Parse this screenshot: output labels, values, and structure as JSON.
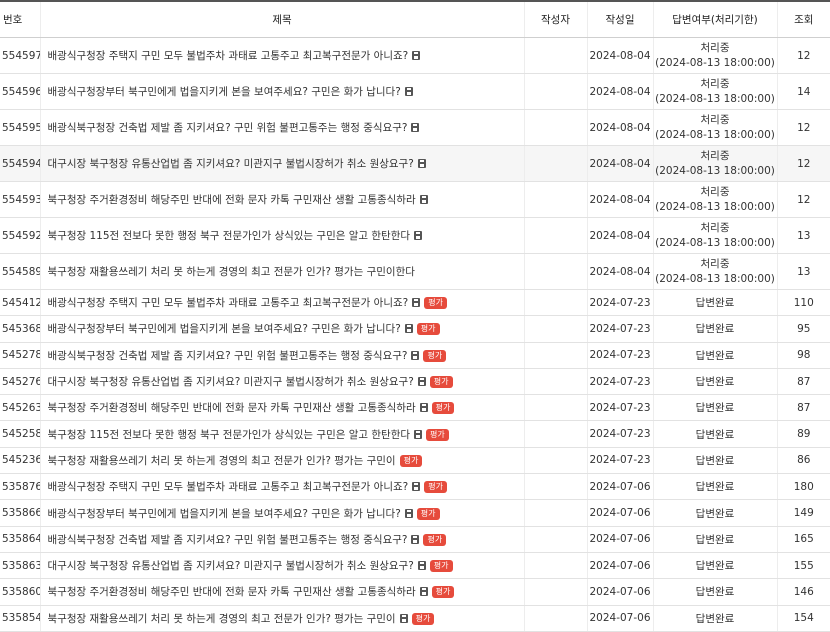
{
  "header": {
    "no": "번호",
    "title": "제목",
    "author": "작성자",
    "date": "작성일",
    "status": "답변여부(처리기한)",
    "views": "조회"
  },
  "badge_label": "평가",
  "icons": {
    "attachment": "floppy-disk-icon"
  },
  "colors": {
    "badge": "#e64b3c"
  },
  "rows": [
    {
      "no": "554597",
      "title": "배광식구청장 주택지 구민 모두 불법주차 과태료 고통주고 최고복구전문가 아니죠?",
      "icon": true,
      "badge": false,
      "author": "",
      "date": "2024-08-04",
      "status": "처리중",
      "deadline": "(2024-08-13 18:00:00)",
      "views": "12"
    },
    {
      "no": "554596",
      "title": "배광식구청장부터 북구민에게 법을지키게 본을 보여주세요? 구민은 화가 납니다?",
      "icon": true,
      "badge": false,
      "author": "",
      "date": "2024-08-04",
      "status": "처리중",
      "deadline": "(2024-08-13 18:00:00)",
      "views": "14"
    },
    {
      "no": "554595",
      "title": "배광식북구청장 건축법 제발 좀 지키셔요? 구민 위험 불편고통주는 행정 중식요구?",
      "icon": true,
      "badge": false,
      "author": "",
      "date": "2024-08-04",
      "status": "처리중",
      "deadline": "(2024-08-13 18:00:00)",
      "views": "12"
    },
    {
      "no": "554594",
      "title": "대구시장 북구청장 유통산업법 좀 지키셔요? 미관지구 불법시장허가 취소 원상요구?",
      "icon": true,
      "badge": false,
      "author": "",
      "date": "2024-08-04",
      "status": "처리중",
      "deadline": "(2024-08-13 18:00:00)",
      "views": "12"
    },
    {
      "no": "554593",
      "title": "북구청장 주거환경정비 해당주민 반대에 전화 문자 카톡 구민재산 생활 고통종식하라",
      "icon": true,
      "badge": false,
      "author": "",
      "date": "2024-08-04",
      "status": "처리중",
      "deadline": "(2024-08-13 18:00:00)",
      "views": "12"
    },
    {
      "no": "554592",
      "title": "북구청장 115전 전보다 못한 행정 북구 전문가인가 상식있는 구민은 알고 한탄한다",
      "icon": true,
      "badge": false,
      "author": "",
      "date": "2024-08-04",
      "status": "처리중",
      "deadline": "(2024-08-13 18:00:00)",
      "views": "13"
    },
    {
      "no": "554589",
      "title": "북구청장 재활용쓰레기 처리 못 하는게 경영의 최고 전문가 인가? 평가는 구민이한다",
      "icon": false,
      "badge": false,
      "author": "",
      "date": "2024-08-04",
      "status": "처리중",
      "deadline": "(2024-08-13 18:00:00)",
      "views": "13"
    },
    {
      "no": "545412",
      "title": "배광식구청장 주택지 구민 모두 불법주차 과태료 고통주고 최고복구전문가 아니죠?",
      "icon": true,
      "badge": true,
      "author": "",
      "date": "2024-07-23",
      "status": "답변완료",
      "deadline": "",
      "views": "110"
    },
    {
      "no": "545368",
      "title": "배광식구청장부터 북구민에게 법을지키게 본을 보여주세요? 구민은 화가 납니다?",
      "icon": true,
      "badge": true,
      "author": "",
      "date": "2024-07-23",
      "status": "답변완료",
      "deadline": "",
      "views": "95"
    },
    {
      "no": "545278",
      "title": "배광식북구청장 건축법 제발 좀 지키셔요? 구민 위험 불편고통주는 행정 중식요구?",
      "icon": true,
      "badge": true,
      "author": "",
      "date": "2024-07-23",
      "status": "답변완료",
      "deadline": "",
      "views": "98"
    },
    {
      "no": "545276",
      "title": "대구시장 북구청장 유통산업법 좀 지키셔요? 미관지구 불법시장허가 취소 원상요구?",
      "icon": true,
      "badge": true,
      "author": "",
      "date": "2024-07-23",
      "status": "답변완료",
      "deadline": "",
      "views": "87"
    },
    {
      "no": "545263",
      "title": "북구청장 주거환경정비 해당주민 반대에 전화 문자 카톡 구민재산 생활 고통종식하라",
      "icon": true,
      "badge": true,
      "author": "",
      "date": "2024-07-23",
      "status": "답변완료",
      "deadline": "",
      "views": "87"
    },
    {
      "no": "545258",
      "title": "북구청장 115전 전보다 못한 행정 북구 전문가인가 상식있는 구민은 알고 한탄한다",
      "icon": true,
      "badge": true,
      "author": "",
      "date": "2024-07-23",
      "status": "답변완료",
      "deadline": "",
      "views": "89"
    },
    {
      "no": "545236",
      "title": "북구청장 재활용쓰레기 처리 못 하는게 경영의 최고 전문가 인가? 평가는 구민이",
      "icon": false,
      "badge": true,
      "author": "",
      "date": "2024-07-23",
      "status": "답변완료",
      "deadline": "",
      "views": "86"
    },
    {
      "no": "535876",
      "title": "배광식구청장 주택지 구민 모두 불법주차 과태료 고통주고 최고복구전문가 아니죠?",
      "icon": true,
      "badge": true,
      "author": "",
      "date": "2024-07-06",
      "status": "답변완료",
      "deadline": "",
      "views": "180"
    },
    {
      "no": "535866",
      "title": "배광식구청장부터 북구민에게 법을지키게 본을 보여주세요? 구민은 화가 납니다?",
      "icon": true,
      "badge": true,
      "author": "",
      "date": "2024-07-06",
      "status": "답변완료",
      "deadline": "",
      "views": "149"
    },
    {
      "no": "535864",
      "title": "배광식북구청장 건축법 제발 좀 지키셔요? 구민 위험 불편고통주는 행정 중식요구?",
      "icon": true,
      "badge": true,
      "author": "",
      "date": "2024-07-06",
      "status": "답변완료",
      "deadline": "",
      "views": "165"
    },
    {
      "no": "535863",
      "title": "대구시장 북구청장 유통산업법 좀 지키셔요? 미관지구 불법시장허가 취소 원상요구?",
      "icon": true,
      "badge": true,
      "author": "",
      "date": "2024-07-06",
      "status": "답변완료",
      "deadline": "",
      "views": "155"
    },
    {
      "no": "535860",
      "title": "북구청장 주거환경정비 해당주민 반대에 전화 문자 카톡 구민재산 생활 고통종식하라",
      "icon": true,
      "badge": true,
      "author": "",
      "date": "2024-07-06",
      "status": "답변완료",
      "deadline": "",
      "views": "146"
    },
    {
      "no": "535854",
      "title": "북구청장 재활용쓰레기 처리 못 하는게 경영의 최고 전문가 인가? 평가는 구민이",
      "icon": true,
      "badge": true,
      "author": "",
      "date": "2024-07-06",
      "status": "답변완료",
      "deadline": "",
      "views": "154"
    }
  ]
}
